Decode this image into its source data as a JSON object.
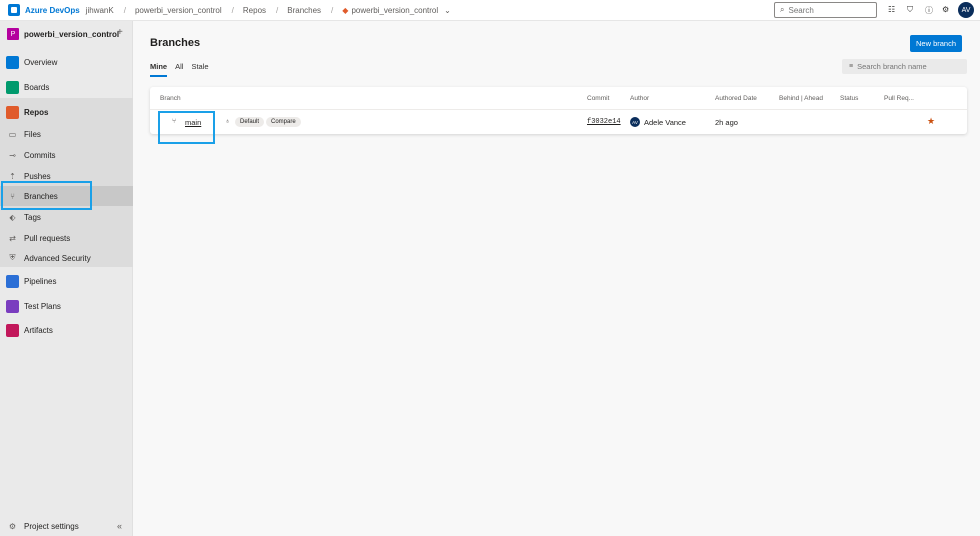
{
  "topbar": {
    "brand": "Azure DevOps",
    "org": "jihwanK",
    "breadcrumbs": [
      "powerbi_version_control",
      "Repos",
      "Branches"
    ],
    "repo": "powerbi_version_control",
    "separator": "/",
    "search_placeholder": "Search",
    "avatar_initials": "AV"
  },
  "sidebar": {
    "project_initial": "P",
    "project_name": "powerbi_version_control",
    "items": {
      "overview": "Overview",
      "boards": "Boards",
      "repos": "Repos",
      "files": "Files",
      "commits": "Commits",
      "pushes": "Pushes",
      "branches": "Branches",
      "tags": "Tags",
      "pull_requests": "Pull requests",
      "advanced_security": "Advanced Security",
      "pipelines": "Pipelines",
      "test_plans": "Test Plans",
      "artifacts": "Artifacts"
    },
    "settings": "Project settings",
    "colors": {
      "overview": "#0078d4",
      "boards": "#009a6d",
      "repos": "#e05b2b",
      "pipelines": "#2b6fd6",
      "test_plans": "#7a3dbf",
      "artifacts": "#c2185b"
    }
  },
  "main": {
    "title": "Branches",
    "new_branch": "New branch",
    "tabs": [
      "Mine",
      "All",
      "Stale"
    ],
    "filter_placeholder": "Search branch name",
    "columns": {
      "branch": "Branch",
      "commit": "Commit",
      "author": "Author",
      "authored_date": "Authored Date",
      "behind_ahead": "Behind | Ahead",
      "status": "Status",
      "pull_request": "Pull Req..."
    },
    "row": {
      "branch": "main",
      "default_tag": "Default",
      "compare": "Compare",
      "commit": "f3032e14",
      "author_initials": "AV",
      "author": "Adele Vance",
      "authored": "2h ago"
    }
  }
}
